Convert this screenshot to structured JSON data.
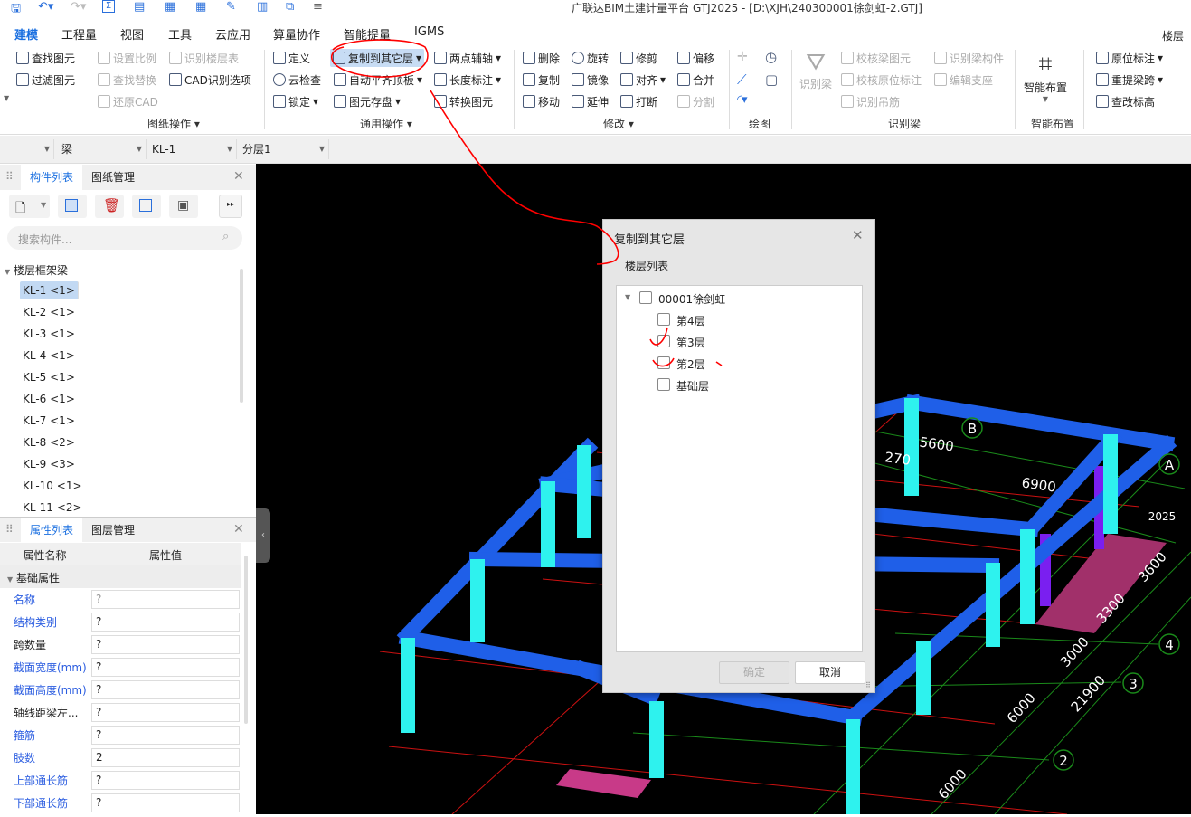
{
  "window": {
    "title": "广联达BIM土建计量平台 GTJ2025 - [D:\\XJH\\240300001徐剑虹-2.GTJ]"
  },
  "quick_access": [
    "save-icon",
    "undo-icon",
    "redo-icon",
    "sum-icon",
    "report-icon",
    "grid-icon",
    "grid-icon",
    "pen-icon",
    "layout-icon",
    "frame-icon",
    "more-icon"
  ],
  "menu": {
    "tabs": [
      "建模",
      "工程量",
      "视图",
      "工具",
      "云应用",
      "算量协作",
      "智能提量",
      "IGMS"
    ],
    "active": "建模",
    "right_label": "楼层三"
  },
  "ribbon": {
    "g1": {
      "items": [
        "查找图元",
        "过滤图元"
      ]
    },
    "g2": {
      "label": "图纸操作",
      "items": [
        "设置比例",
        "识别楼层表",
        "查找替换",
        "CAD识别选项",
        "还原CAD"
      ]
    },
    "g3": {
      "label": "通用操作",
      "items": [
        "定义",
        "云检查",
        "锁定",
        "复制到其它层",
        "自动平齐顶板",
        "图元存盘",
        "两点辅轴",
        "长度标注",
        "转换图元"
      ]
    },
    "g4": {
      "label": "修改",
      "items": [
        "删除",
        "复制",
        "移动",
        "旋转",
        "镜像",
        "延伸",
        "修剪",
        "对齐",
        "打断",
        "偏移",
        "合并",
        "分割"
      ]
    },
    "g5": {
      "label": "绘图"
    },
    "g6": {
      "label": "识别梁",
      "big": "识别梁",
      "items": [
        "校核梁图元",
        "校核原位标注",
        "识别吊筋",
        "识别梁构件",
        "编辑支座"
      ]
    },
    "g7": {
      "label": "智能布置",
      "big": "智能布置"
    },
    "g8": {
      "items": [
        "原位标注",
        "重提梁跨",
        "查改标高"
      ]
    }
  },
  "selectors": [
    "",
    "梁",
    "KL-1",
    "分层1"
  ],
  "component_panel": {
    "tabs": [
      "构件列表",
      "图纸管理"
    ],
    "search_placeholder": "搜索构件...",
    "group": "楼层框架梁",
    "items": [
      "KL-1 <1>",
      "KL-2 <1>",
      "KL-3 <1>",
      "KL-4 <1>",
      "KL-5 <1>",
      "KL-6 <1>",
      "KL-7 <1>",
      "KL-8 <2>",
      "KL-9 <3>",
      "KL-10 <1>",
      "KL-11 <2>"
    ],
    "selected": 0
  },
  "property_panel": {
    "tabs": [
      "属性列表",
      "图层管理"
    ],
    "headers": [
      "属性名称",
      "属性值"
    ],
    "group": "基础属性",
    "rows": [
      {
        "name": "名称",
        "value": "?",
        "blue": true
      },
      {
        "name": "结构类别",
        "value": "?",
        "blue": true
      },
      {
        "name": "跨数量",
        "value": "?",
        "blue": false
      },
      {
        "name": "截面宽度(mm)",
        "value": "?",
        "blue": true
      },
      {
        "name": "截面高度(mm)",
        "value": "?",
        "blue": true
      },
      {
        "name": "轴线距梁左...",
        "value": "?",
        "blue": false
      },
      {
        "name": "箍筋",
        "value": "?",
        "blue": true
      },
      {
        "name": "肢数",
        "value": "2",
        "blue": true
      },
      {
        "name": "上部通长筋",
        "value": "?",
        "blue": true
      },
      {
        "name": "下部通长筋",
        "value": "?",
        "blue": true
      }
    ]
  },
  "dialog": {
    "title": "复制到其它层",
    "section": "楼层列表",
    "root": "00001徐剑虹",
    "floors": [
      "第4层",
      "第3层",
      "第2层",
      "基础层"
    ],
    "ok": "确定",
    "cancel": "取消"
  },
  "viewport": {
    "axis_labels": [
      "A",
      "B",
      "2",
      "3",
      "4"
    ],
    "dimensions": [
      "6900",
      "5600",
      "270",
      "3600",
      "3300",
      "3000",
      "21900",
      "6000",
      "6000",
      "2025"
    ]
  },
  "colors": {
    "accent": "#1a6fe0",
    "beam": "#1f5fe8",
    "column": "#2ef2ee",
    "slab": "#b0336f",
    "annotation": "#ff0000"
  }
}
